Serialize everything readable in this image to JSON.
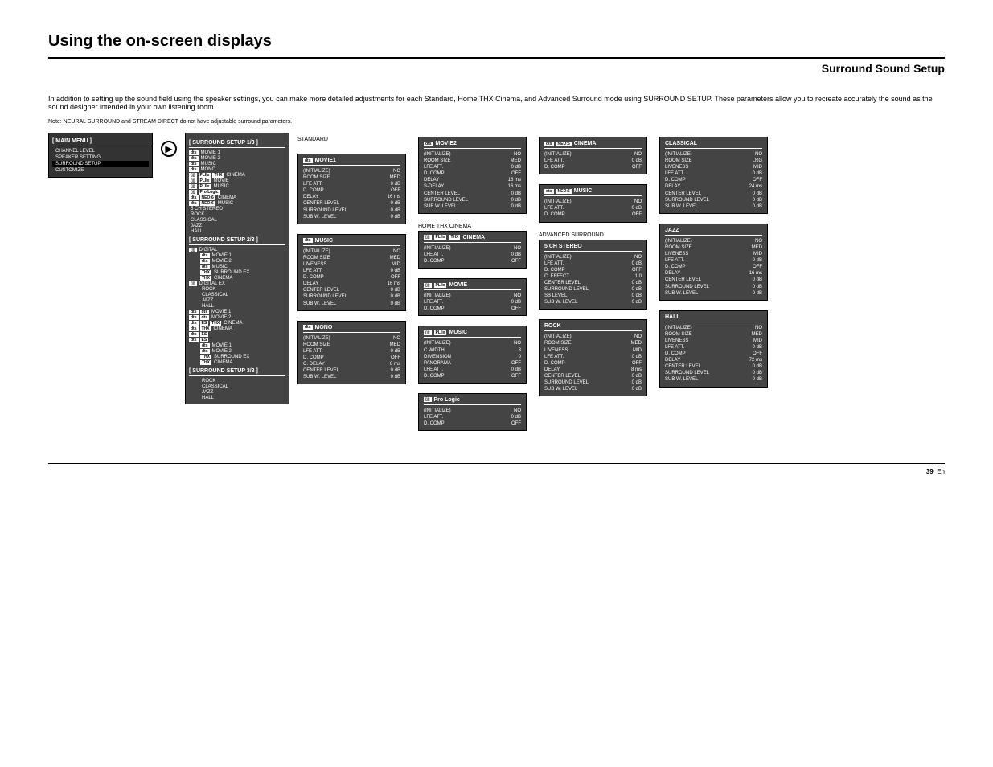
{
  "header": {
    "title": "Using the on-screen displays",
    "subtitle": "Surround Sound Setup",
    "intro": "In addition to setting up the sound field using the speaker settings, you can make more detailed adjustments for each Standard, Home THX Cinema, and Advanced Surround mode using SURROUND SETUP. These parameters allow you to recreate accurately the sound as the sound designer intended in your own listening room.",
    "note": "Note: NEURAL SURROUND and STREAM DIRECT do not have adjustable surround parameters."
  },
  "main_menu": {
    "title": "[ MAIN MENU ]",
    "items": [
      "CHANNEL LEVEL",
      "SPEAKER SETTING",
      "SURROUND SETUP",
      "CUSTOMIZE"
    ],
    "selected": 2
  },
  "surround_setup": {
    "sections": [
      {
        "title": "[    SURROUND SETUP 1/3   ]",
        "rows": [
          {
            "logos": [
              "dts"
            ],
            "text": "MOVIE 1"
          },
          {
            "logos": [
              "dts"
            ],
            "text": "MOVIE 2"
          },
          {
            "logos": [
              "dts"
            ],
            "text": "MUSIC"
          },
          {
            "logos": [
              "dts"
            ],
            "text": "MONO"
          },
          {
            "logos": [
              "DD",
              "Plx",
              "THX"
            ],
            "text": "CINEMA"
          },
          {
            "logos": [
              "DD",
              "Plx"
            ],
            "text": "MOVIE"
          },
          {
            "logos": [
              "DD",
              "Plx"
            ],
            "text": "MUSIC"
          },
          {
            "logos": [
              "DD",
              "Pro Logic"
            ],
            "text": ""
          },
          {
            "logos": [
              "dts",
              "neo6"
            ],
            "text": "CINEMA"
          },
          {
            "logos": [
              "dts",
              "neo6"
            ],
            "text": "MUSIC"
          },
          {
            "logos": [],
            "text": "5 CH STEREO"
          },
          {
            "logos": [],
            "text": "ROCK"
          },
          {
            "logos": [],
            "text": "CLASSICAL"
          },
          {
            "logos": [],
            "text": "JAZZ"
          },
          {
            "logos": [],
            "text": "HALL"
          }
        ]
      },
      {
        "title": "[    SURROUND SETUP 2/3   ]",
        "rows": [
          {
            "logos": [
              "DD"
            ],
            "text": "DIGITAL",
            "indent": false
          },
          {
            "logos": [
              "dts"
            ],
            "text": "MOVIE 1",
            "indent": true
          },
          {
            "logos": [
              "dts"
            ],
            "text": "MOVIE 2",
            "indent": true
          },
          {
            "logos": [
              "dts"
            ],
            "text": "MUSIC",
            "indent": true
          },
          {
            "logos": [
              "THX"
            ],
            "text": "SURROUND EX",
            "indent": true
          },
          {
            "logos": [
              "THX"
            ],
            "text": "CINEMA",
            "indent": true
          },
          {
            "logos": [
              "DD"
            ],
            "text": "DIGITAL EX",
            "indent": false
          },
          {
            "logos": [],
            "text": "ROCK",
            "indent": true
          },
          {
            "logos": [],
            "text": "CLASSICAL",
            "indent": true
          },
          {
            "logos": [],
            "text": "JAZZ",
            "indent": true
          },
          {
            "logos": [],
            "text": "HALL",
            "indent": true
          },
          {
            "logos": [
              "dts",
              "dts"
            ],
            "text": "MOVIE 1",
            "indent": false
          },
          {
            "logos": [
              "dts",
              "dts"
            ],
            "text": "MOVIE 2",
            "indent": false
          },
          {
            "logos": [
              "dts",
              "ES",
              "THX"
            ],
            "text": "CINEMA",
            "indent": false
          },
          {
            "logos": [
              "dts",
              "THX"
            ],
            "text": "CINEMA",
            "indent": false
          },
          {
            "logos": [
              "dts",
              "ES"
            ],
            "text": "",
            "indent": false
          },
          {
            "logos": [
              "dts",
              "ES"
            ],
            "text": "",
            "indent": false
          },
          {
            "logos": [
              "dts"
            ],
            "text": "MOVIE 1",
            "indent": true
          },
          {
            "logos": [
              "dts"
            ],
            "text": "MOVIE 2",
            "indent": true
          },
          {
            "logos": [
              "THX"
            ],
            "text": "SURROUND EX",
            "indent": true
          },
          {
            "logos": [
              "THX"
            ],
            "text": "CINEMA",
            "indent": true
          }
        ]
      },
      {
        "title": "[    SURROUND SETUP 3/3   ]",
        "rows": [
          {
            "logos": [],
            "text": "ROCK",
            "indent": true
          },
          {
            "logos": [],
            "text": "CLASSICAL",
            "indent": true
          },
          {
            "logos": [],
            "text": "JAZZ",
            "indent": true
          },
          {
            "logos": [],
            "text": "HALL",
            "indent": true
          }
        ]
      }
    ]
  },
  "desc_boxes": {
    "label_standard": "STANDARD",
    "label_thx": "HOME THX CINEMA",
    "label_advanced": "ADVANCED SURROUND",
    "col1": [
      {
        "header_logos": [
          "dts"
        ],
        "header_text": "MOVIE1",
        "body": "(INITIALIZE)\nROOM SIZE\nLFE ATT.\nD. COMP\nDELAY\nCENTER LEVEL\nSURROUND LEVEL\nSUB W. LEVEL",
        "values": "NO\nMED\n0 dB\nOFF\n16 ms\n0 dB\n0 dB\n0 dB"
      },
      {
        "header_logos": [
          "dts"
        ],
        "header_text": "MUSIC",
        "body": "(INITIALIZE)\nROOM SIZE\nLIVENESS\nLFE ATT.\nD. COMP\nDELAY\nCENTER LEVEL\nSURROUND LEVEL\nSUB W. LEVEL",
        "values": "NO\nMED\nMID\n0 dB\nOFF\n16 ms\n0 dB\n0 dB\n0 dB"
      },
      {
        "header_logos": [
          "dts"
        ],
        "header_text": "MONO",
        "body": "(INITIALIZE)\nROOM SIZE\nLFE ATT.\nD. COMP\nC. DELAY\nCENTER LEVEL\nSUB W. LEVEL",
        "values": "NO\nMED\n0 dB\nOFF\n8 ms\n0 dB\n0 dB"
      }
    ],
    "col2": [
      {
        "header_logos": [
          "dts"
        ],
        "header_text": "MOVIE2",
        "body": "(INITIALIZE)\nROOM SIZE\nLFE ATT.\nD. COMP\nDELAY\nS-DELAY\nCENTER LEVEL\nSURROUND LEVEL\nSUB W. LEVEL",
        "values": "NO\nMED\n0 dB\nOFF\n16 ms\n16 ms\n0 dB\n0 dB\n0 dB"
      },
      {
        "header_logos": [
          "DD",
          "Plx",
          "THX"
        ],
        "header_text": "CINEMA",
        "body": "(INITIALIZE)\nLFE ATT.\nD. COMP",
        "values": "NO\n0 dB\nOFF"
      },
      {
        "header_logos": [
          "DD",
          "Plx"
        ],
        "header_text": "MOVIE",
        "body": "(INITIALIZE)\nLFE ATT.\nD. COMP",
        "values": "NO\n0 dB\nOFF"
      },
      {
        "header_logos": [
          "DD",
          "Plx"
        ],
        "header_text": "MUSIC",
        "body": "(INITIALIZE)\nC WIDTH\nDIMENSION\nPANORAMA\nLFE ATT.\nD. COMP",
        "values": "NO\n3\n0\nOFF\n0 dB\nOFF"
      },
      {
        "header_logos": [
          "DD"
        ],
        "header_text": "Pro Logic",
        "body": "(INITIALIZE)\nLFE ATT.\nD. COMP",
        "values": "NO\n0 dB\nOFF"
      }
    ],
    "col3": [
      {
        "header_logos": [
          "dts",
          "neo6"
        ],
        "header_text": "CINEMA",
        "body": "(INITIALIZE)\nLFE ATT.\nD. COMP",
        "values": "NO\n0 dB\nOFF"
      },
      {
        "header_logos": [
          "dts",
          "neo6"
        ],
        "header_text": "MUSIC",
        "body": "(INITIALIZE)\nLFE ATT.\nD. COMP",
        "values": "NO\n0 dB\nOFF"
      },
      {
        "header_logos": [],
        "header_text": "5 CH STEREO",
        "body": "(INITIALIZE)\nLFE ATT.\nD. COMP\nC. EFFECT\nCENTER LEVEL\nSURROUND LEVEL\nSB LEVEL\nSUB W. LEVEL",
        "values": "NO\n0 dB\nOFF\n1.0\n0 dB\n0 dB\n0 dB\n0 dB"
      },
      {
        "header_logos": [],
        "header_text": "ROCK",
        "body": "(INITIALIZE)\nROOM SIZE\nLIVENESS\nLFE ATT.\nD. COMP\nDELAY\nCENTER LEVEL\nSURROUND LEVEL\nSUB W. LEVEL",
        "values": "NO\nMED\nMID\n0 dB\nOFF\n8 ms\n0 dB\n0 dB\n0 dB"
      }
    ],
    "col4": [
      {
        "header_logos": [],
        "header_text": "CLASSICAL",
        "body": "(INITIALIZE)\nROOM SIZE\nLIVENESS\nLFE ATT.\nD. COMP\nDELAY\nCENTER LEVEL\nSURROUND LEVEL\nSUB W. LEVEL",
        "values": "NO\nLRG\nMID\n0 dB\nOFF\n24 ms\n0 dB\n0 dB\n0 dB"
      },
      {
        "header_logos": [],
        "header_text": "JAZZ",
        "body": "(INITIALIZE)\nROOM SIZE\nLIVENESS\nLFE ATT.\nD. COMP\nDELAY\nCENTER LEVEL\nSURROUND LEVEL\nSUB W. LEVEL",
        "values": "NO\nMED\nMID\n0 dB\nOFF\n16 ms\n0 dB\n0 dB\n0 dB"
      },
      {
        "header_logos": [],
        "header_text": "HALL",
        "body": "(INITIALIZE)\nROOM SIZE\nLIVENESS\nLFE ATT.\nD. COMP\nDELAY\nCENTER LEVEL\nSURROUND LEVEL\nSUB W. LEVEL",
        "values": "NO\nMED\nMID\n0 dB\nOFF\n72 ms\n0 dB\n0 dB\n0 dB"
      }
    ]
  },
  "footer": {
    "page": "39",
    "lang": "En"
  }
}
